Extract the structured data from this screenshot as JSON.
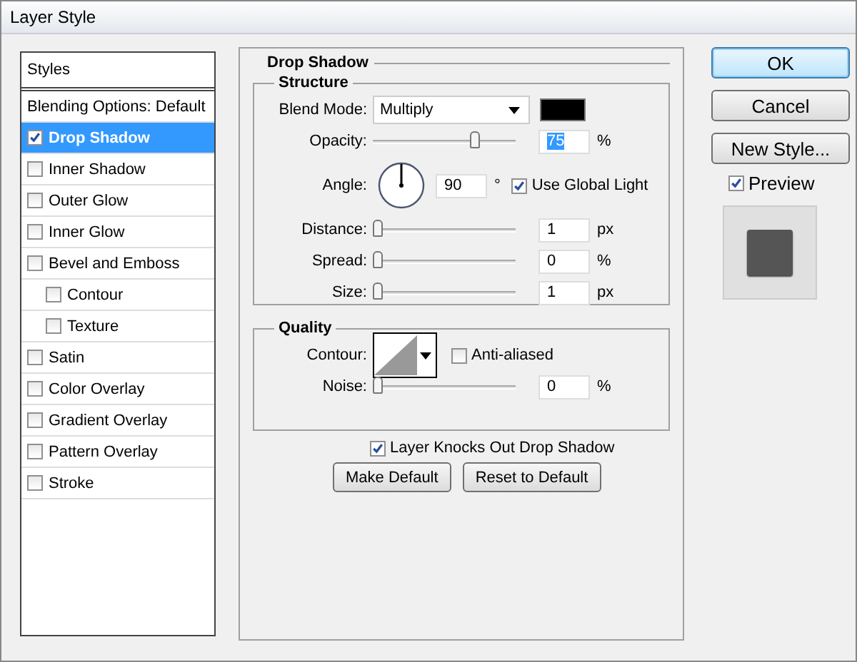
{
  "window": {
    "title": "Layer Style"
  },
  "styles": {
    "header": "Styles",
    "items": [
      {
        "label": "Blending Options: Default",
        "kind": "plain",
        "selected": false
      },
      {
        "label": "Drop Shadow",
        "kind": "check",
        "checked": true,
        "selected": true
      },
      {
        "label": "Inner Shadow",
        "kind": "check",
        "checked": false,
        "selected": false
      },
      {
        "label": "Outer Glow",
        "kind": "check",
        "checked": false,
        "selected": false
      },
      {
        "label": "Inner Glow",
        "kind": "check",
        "checked": false,
        "selected": false
      },
      {
        "label": "Bevel and Emboss",
        "kind": "check",
        "checked": false,
        "selected": false,
        "children": [
          {
            "label": "Contour",
            "kind": "check",
            "checked": false,
            "selected": false
          },
          {
            "label": "Texture",
            "kind": "check",
            "checked": false,
            "selected": false
          }
        ]
      },
      {
        "label": "Satin",
        "kind": "check",
        "checked": false,
        "selected": false
      },
      {
        "label": "Color Overlay",
        "kind": "check",
        "checked": false,
        "selected": false
      },
      {
        "label": "Gradient Overlay",
        "kind": "check",
        "checked": false,
        "selected": false
      },
      {
        "label": "Pattern Overlay",
        "kind": "check",
        "checked": false,
        "selected": false
      },
      {
        "label": "Stroke",
        "kind": "check",
        "checked": false,
        "selected": false
      }
    ]
  },
  "drop_shadow": {
    "title": "Drop Shadow",
    "structure": {
      "title": "Structure",
      "blend_mode": {
        "label": "Blend Mode:",
        "value": "Multiply",
        "color": "#000000"
      },
      "rows": [
        {
          "kind": "slider",
          "label": "Opacity:",
          "value": "75",
          "unit": "%",
          "level": 0.76,
          "text_selected": true
        },
        {
          "kind": "angle",
          "label": "Angle:",
          "value": "90",
          "unit": "°",
          "global_light": {
            "label": "Use Global Light",
            "checked": true
          }
        },
        {
          "kind": "slider",
          "label": "Distance:",
          "value": "1",
          "unit": "px",
          "level": 0,
          "text_selected": false
        },
        {
          "kind": "slider",
          "label": "Spread:",
          "value": "0",
          "unit": "%",
          "level": 0,
          "text_selected": false
        },
        {
          "kind": "slider",
          "label": "Size:",
          "value": "1",
          "unit": "px",
          "level": 0,
          "text_selected": false
        }
      ]
    },
    "quality": {
      "title": "Quality",
      "contour": {
        "label": "Contour:"
      },
      "anti_aliased": {
        "label": "Anti-aliased",
        "checked": false
      },
      "noise": {
        "label": "Noise:",
        "value": "0",
        "unit": "%",
        "level": 0
      }
    },
    "knockout": {
      "label": "Layer Knocks Out Drop Shadow",
      "checked": true
    },
    "buttons": [
      "Make Default",
      "Reset to Default"
    ]
  },
  "actions": [
    {
      "label": "OK",
      "default": true
    },
    {
      "label": "Cancel",
      "default": false
    },
    {
      "label": "New Style...",
      "default": false
    }
  ],
  "preview": {
    "label": "Preview",
    "checked": true
  }
}
